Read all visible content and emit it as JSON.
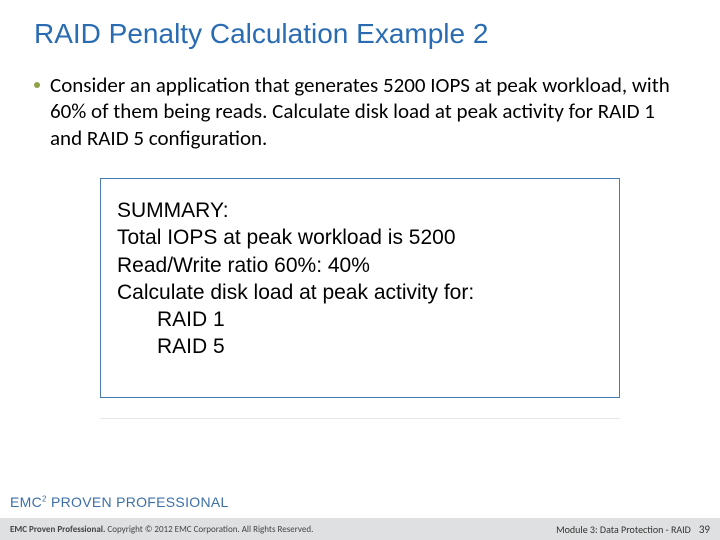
{
  "title": "RAID Penalty Calculation Example 2",
  "bullet": "Consider an application that generates 5200 IOPS at peak workload, with 60% of them being reads. Calculate disk load at peak activity for RAID 1 and RAID 5 configuration.",
  "summary": {
    "heading": "SUMMARY:",
    "lines": [
      "Total IOPS at peak workload is 5200",
      "Read/Write ratio 60%: 40%",
      "Calculate disk load at peak activity for:"
    ],
    "indented": [
      "RAID 1",
      "RAID 5"
    ]
  },
  "footer": {
    "brand_prefix": "EMC",
    "brand_super": "2",
    "brand_suffix": " PROVEN PROFESSIONAL",
    "copyright_bold": "EMC Proven Professional.",
    "copyright_rest": " Copyright © 2012 EMC Corporation. All Rights Reserved.",
    "module": "Module 3: Data Protection - RAID",
    "page": "39"
  }
}
